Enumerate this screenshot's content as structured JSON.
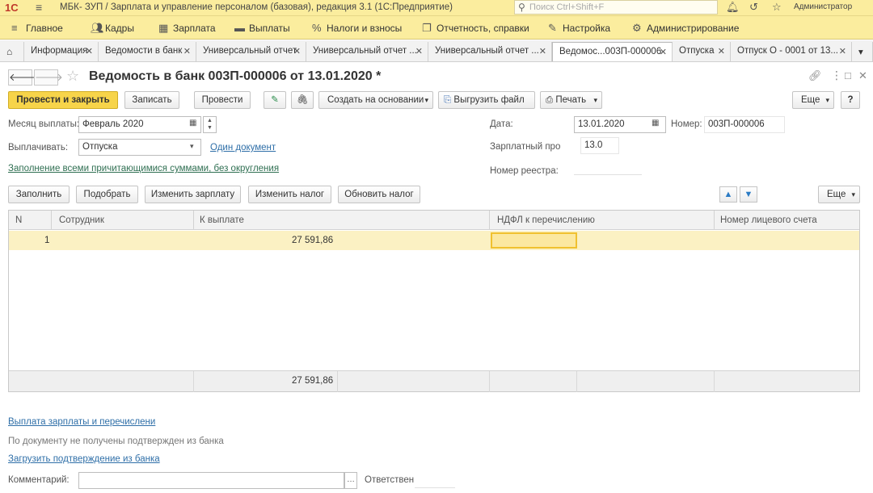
{
  "window": {
    "logo": "1С",
    "title": "МБК- ЗУП / Зарплата и управление персоналом (базовая), редакция 3.1  (1С:Предприятие)",
    "search_placeholder": "Поиск Ctrl+Shift+F",
    "user": "Администратор"
  },
  "sections": [
    {
      "label": "Главное",
      "icon": "menu-icon"
    },
    {
      "label": "Кадры",
      "icon": "people-icon"
    },
    {
      "label": "Зарплата",
      "icon": "calculator-icon"
    },
    {
      "label": "Выплаты",
      "icon": "wallet-icon"
    },
    {
      "label": "Налоги и взносы",
      "icon": "percent-icon"
    },
    {
      "label": "Отчетность, справки",
      "icon": "report-icon"
    },
    {
      "label": "Настройка",
      "icon": "wrench-icon"
    },
    {
      "label": "Администрирование",
      "icon": "gear-icon"
    }
  ],
  "tabs": [
    {
      "label": "Информация"
    },
    {
      "label": "Ведомости в банк"
    },
    {
      "label": "Универсальный отчет"
    },
    {
      "label": "Универсальный отчет ..."
    },
    {
      "label": "Универсальный отчет ..."
    },
    {
      "label": "Ведомос...003П-000006",
      "active": true
    },
    {
      "label": "Отпуска"
    },
    {
      "label": "Отпуск О - 0001 от 13..."
    }
  ],
  "document": {
    "title": "Ведомость в банк 003П-000006 от 13.01.2020 *"
  },
  "toolbar": {
    "post_close": "Провести и закрыть",
    "save": "Записать",
    "post": "Провести",
    "create_based": "Создать на основании",
    "export_file": "Выгрузить файл",
    "print": "Печать",
    "more": "Еще"
  },
  "form": {
    "month_label": "Месяц выплаты:",
    "month_value": "Февраль 2020",
    "pay_label": "Выплачивать:",
    "pay_value": "Отпуска",
    "one_doc_link": "Один документ",
    "fill_link": "Заполнение всеми причитающимися суммами, без округления",
    "date_label": "Дата:",
    "date_value": "13.01.2020",
    "number_label": "Номер:",
    "number_value": "003П-000006",
    "salary_project_label": "Зарплатный про",
    "salary_project_value": "13.0",
    "registry_label": "Номер реестра:"
  },
  "table_toolbar": {
    "fill": "Заполнить",
    "select": "Подобрать",
    "change_salary": "Изменить зарплату",
    "change_tax": "Изменить налог",
    "update_tax": "Обновить налог",
    "more": "Еще"
  },
  "table": {
    "columns": [
      "N",
      "Сотрудник",
      "К выплате",
      "НДФЛ к перечислению",
      "Номер лицевого счета"
    ],
    "rows": [
      {
        "n": "1",
        "employee": "",
        "amount": "27 591,86",
        "ndfl": "",
        "account": ""
      }
    ],
    "total": "27 591,86"
  },
  "bottom": {
    "payment_link": "Выплата зарплаты и перечислени",
    "confirm_text": "По документу не получены подтвержден из банка",
    "load_link": "Загрузить подтверждение из банка",
    "comment_label": "Комментарий:",
    "responsible_label": "Ответствен"
  }
}
